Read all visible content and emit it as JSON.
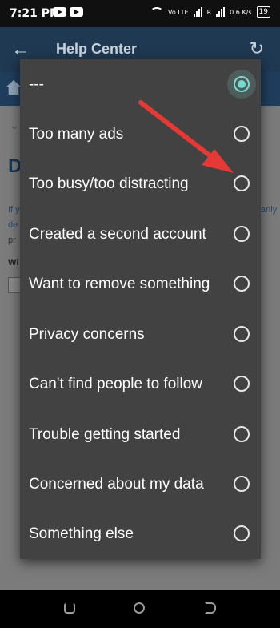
{
  "status_bar": {
    "time": "7:21 PM",
    "network_label": "Vo LTE",
    "signal_label": "R",
    "data_speed": "0.6 K/s",
    "battery": "19"
  },
  "app_bar": {
    "title": "Help Center"
  },
  "background_page": {
    "heading_letter": "D",
    "text_line1_start": "If y",
    "text_line1_end": "arily",
    "text_line2_start": "de",
    "text_line3_start": "pr",
    "text_line4_start": "Wl"
  },
  "dialog": {
    "options": [
      {
        "label": "---",
        "selected": true
      },
      {
        "label": "Too many ads",
        "selected": false
      },
      {
        "label": "Too busy/too distracting",
        "selected": false
      },
      {
        "label": "Created a second account",
        "selected": false
      },
      {
        "label": "Want to remove something",
        "selected": false
      },
      {
        "label": "Privacy concerns",
        "selected": false
      },
      {
        "label": "Can't find people to follow",
        "selected": false
      },
      {
        "label": "Trouble getting started",
        "selected": false
      },
      {
        "label": "Concerned about my data",
        "selected": false
      },
      {
        "label": "Something else",
        "selected": false
      }
    ]
  },
  "colors": {
    "accent": "#79d8cf",
    "dialog_bg": "#424242",
    "arrow": "#e53935"
  }
}
